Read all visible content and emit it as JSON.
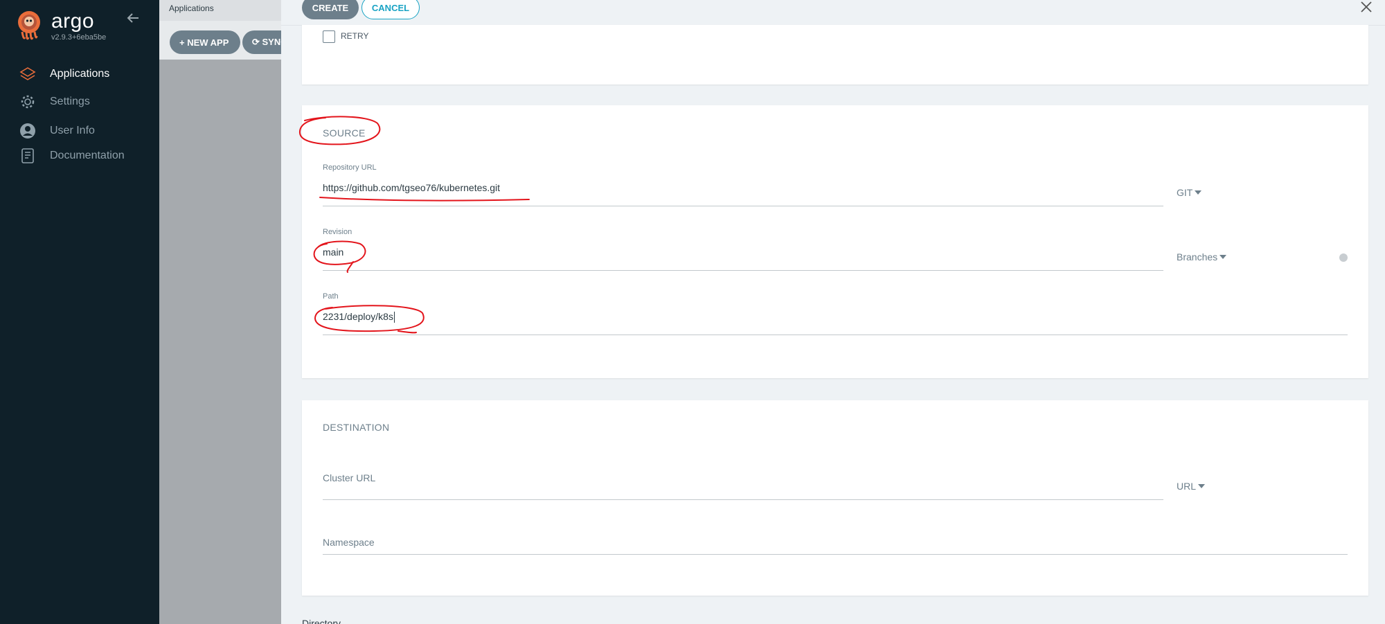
{
  "sidebar": {
    "brand": "argo",
    "version": "v2.9.3+6eba5be",
    "items": [
      {
        "label": "Applications",
        "icon": "layers-icon"
      },
      {
        "label": "Settings",
        "icon": "gear-icon"
      },
      {
        "label": "User Info",
        "icon": "user-icon"
      },
      {
        "label": "Documentation",
        "icon": "book-icon"
      }
    ]
  },
  "background": {
    "header_title": "Applications",
    "new_app_label": "+ NEW APP",
    "sync_label": "⟳ SYNC"
  },
  "panel": {
    "create_label": "CREATE",
    "cancel_label": "CANCEL",
    "retry_label": "RETRY",
    "source": {
      "title": "SOURCE",
      "repo_label": "Repository URL",
      "repo_value": "https://github.com/tgseo76/kubernetes.git",
      "repo_type": "GIT",
      "revision_label": "Revision",
      "revision_value": "main",
      "revision_type": "Branches",
      "path_label": "Path",
      "path_value": "2231/deploy/k8s"
    },
    "destination": {
      "title": "DESTINATION",
      "cluster_placeholder": "Cluster URL",
      "cluster_type": "URL",
      "namespace_placeholder": "Namespace"
    },
    "below_label": "Directory"
  },
  "colors": {
    "sidebar_bg": "#0f2029",
    "accent_button": "#6d7f8b",
    "cancel_teal": "#19a3c4",
    "annotation_red": "#e3141b"
  }
}
